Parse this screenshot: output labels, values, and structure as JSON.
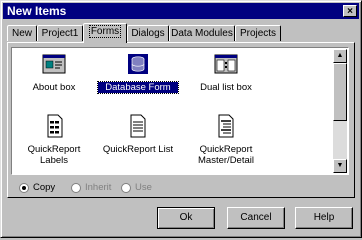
{
  "window": {
    "title": "New Items",
    "close_glyph": "×"
  },
  "tabs": [
    {
      "label": "New"
    },
    {
      "label": "Project1"
    },
    {
      "label": "Forms"
    },
    {
      "label": "Dialogs"
    },
    {
      "label": "Data Modules"
    },
    {
      "label": "Projects"
    }
  ],
  "active_tab": "Forms",
  "items": [
    {
      "label": "About box",
      "icon": "about-box-icon"
    },
    {
      "label": "Database Form",
      "icon": "database-form-icon",
      "selected": true
    },
    {
      "label": "Dual list box",
      "icon": "dual-list-box-icon"
    },
    {
      "label": "QuickReport Labels",
      "icon": "quickreport-labels-icon"
    },
    {
      "label": "QuickReport List",
      "icon": "quickreport-list-icon"
    },
    {
      "label": "QuickReport Master/Detail",
      "icon": "quickreport-master-detail-icon"
    }
  ],
  "options": {
    "copy": "Copy",
    "inherit": "Inherit",
    "use": "Use",
    "selected": "Copy"
  },
  "buttons": {
    "ok": "Ok",
    "cancel": "Cancel",
    "help": "Help"
  }
}
